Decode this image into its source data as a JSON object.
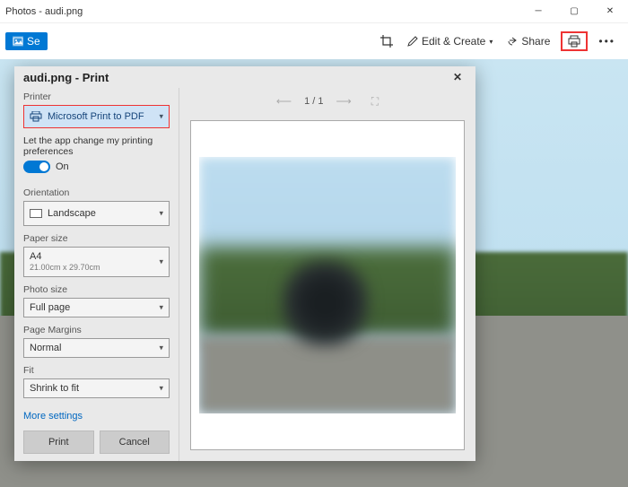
{
  "window": {
    "title": "Photos - audi.png"
  },
  "toolbar": {
    "see_label": "Se",
    "edit_create": "Edit & Create",
    "share": "Share"
  },
  "print_dialog": {
    "title": "audi.png - Print",
    "printer_label": "Printer",
    "printer_value": "Microsoft Print to PDF",
    "pref_text": "Let the app change my printing preferences",
    "toggle_on": "On",
    "orientation_label": "Orientation",
    "orientation_value": "Landscape",
    "paper_size_label": "Paper size",
    "paper_size_value": "A4",
    "paper_size_sub": "21.00cm x 29.70cm",
    "photo_size_label": "Photo size",
    "photo_size_value": "Full page",
    "page_margins_label": "Page Margins",
    "page_margins_value": "Normal",
    "fit_label": "Fit",
    "fit_value": "Shrink to fit",
    "more_settings": "More settings",
    "print_button": "Print",
    "cancel_button": "Cancel",
    "page_indicator": "1 / 1"
  }
}
